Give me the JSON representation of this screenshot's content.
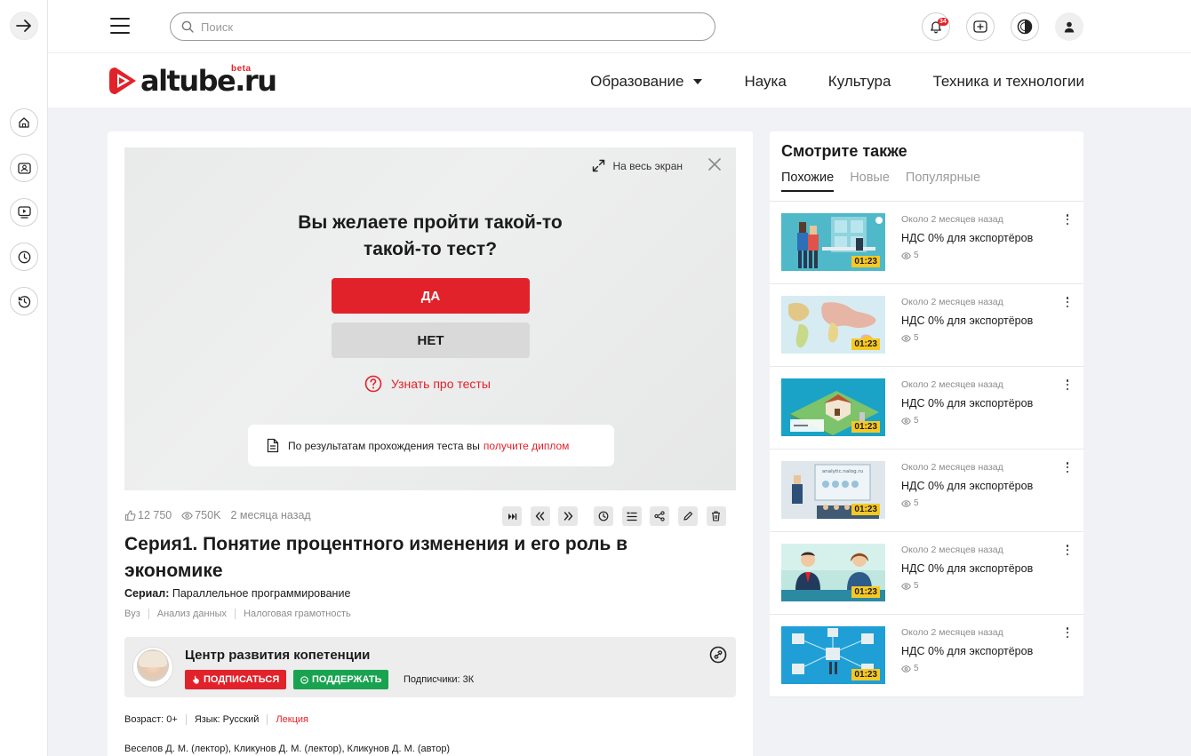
{
  "topbar": {
    "search_placeholder": "Поиск",
    "notifications_count": "34"
  },
  "logo": {
    "text": "altube.ru",
    "beta": "beta"
  },
  "nav": {
    "items": [
      {
        "label": "Образование"
      },
      {
        "label": "Наука"
      },
      {
        "label": "Культура"
      },
      {
        "label": "Техника и технологии"
      }
    ]
  },
  "player": {
    "fullscreen_label": "На весь экран",
    "question_line1": "Вы желаете пройти такой-то",
    "question_line2": "такой-то тест?",
    "yes_label": "ДА",
    "no_label": "НЕТ",
    "learn_label": "Узнать про тесты",
    "diploma_text": "По результатам прохождения теста вы",
    "diploma_link": "получите диплом"
  },
  "video": {
    "likes": "12 750",
    "views": "750K",
    "posted": "2 месяца назад",
    "title": "Серия1. Понятие процентного изменения и его роль в экономике",
    "serial_label": "Сериал:",
    "serial_value": "Параллельное программирование",
    "tags": [
      "Вуз",
      "Анализ данных",
      "Налоговая грамотность"
    ]
  },
  "channel": {
    "name": "Центр развития копетенции",
    "subscribe_label": "ПОДПИСАТЬСЯ",
    "support_label": "ПОДДЕРЖАТЬ",
    "subscribers": "Подписчики: 3К"
  },
  "meta": {
    "age": "Возраст: 0+",
    "language": "Язык: Русский",
    "type": "Лекция"
  },
  "authors": "Веселов Д. М. (лектор), Кликунов Д. М. (лектор), Кликунов Д. М. (автор)",
  "sidebar": {
    "title": "Смотрите также",
    "tabs": [
      "Похожие",
      "Новые",
      "Популярные"
    ],
    "items": [
      {
        "when": "Около 2 месяцев назад",
        "title": "НДС 0% для экспортёров",
        "views": "5",
        "duration": "01:23"
      },
      {
        "when": "Около 2 месяцев назад",
        "title": "НДС 0% для экспортёров",
        "views": "5",
        "duration": "01:23"
      },
      {
        "when": "Около 2 месяцев назад",
        "title": "НДС 0% для экспортёров",
        "views": "5",
        "duration": "01:23"
      },
      {
        "when": "Около 2 месяцев назад",
        "title": "НДС 0% для экспортёров",
        "views": "5",
        "duration": "01:23"
      },
      {
        "when": "Около 2 месяцев назад",
        "title": "НДС 0% для экспортёров",
        "views": "5",
        "duration": "01:23"
      },
      {
        "when": "Около 2 месяцев назад",
        "title": "НДС 0% для экспортёров",
        "views": "5",
        "duration": "01:23"
      }
    ],
    "thumb4_caption": "analytic.nalog.ru"
  },
  "colors": {
    "accent": "#e2222a",
    "support": "#19a350",
    "duration_badge": "#f7c824"
  }
}
